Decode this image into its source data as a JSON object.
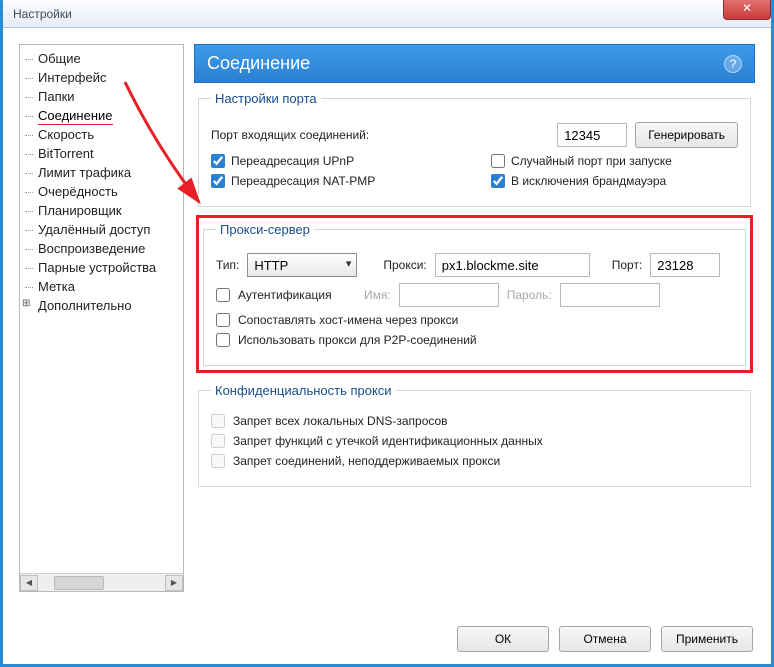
{
  "window": {
    "title": "Настройки"
  },
  "tree": {
    "items": [
      "Общие",
      "Интерфейс",
      "Папки",
      "Соединение",
      "Скорость",
      "BitTorrent",
      "Лимит трафика",
      "Очерёдность",
      "Планировщик",
      "Удалённый доступ",
      "Воспроизведение",
      "Парные устройства",
      "Метка",
      "Дополнительно"
    ],
    "selectedIndex": 3,
    "expandableIndex": 13
  },
  "header": {
    "title": "Соединение"
  },
  "portSettings": {
    "legend": "Настройки порта",
    "portLabel": "Порт входящих соединений:",
    "portValue": "12345",
    "generateBtn": "Генерировать",
    "upnp": "Переадресация UPnP",
    "upnpChecked": true,
    "natpmp": "Переадресация NAT-PMP",
    "natpmpChecked": true,
    "randomPort": "Случайный порт при запуске",
    "randomPortChecked": false,
    "firewall": "В исключения брандмауэра",
    "firewallChecked": true
  },
  "proxy": {
    "legend": "Прокси-сервер",
    "typeLabel": "Тип:",
    "typeValue": "HTTP",
    "proxyLabel": "Прокси:",
    "proxyValue": "px1.blockme.site",
    "portLabel": "Порт:",
    "portValue": "23128",
    "auth": "Аутентификация",
    "authChecked": false,
    "userLabel": "Имя:",
    "userValue": "",
    "passLabel": "Пароль:",
    "passValue": "",
    "hostnames": "Сопоставлять хост-имена через прокси",
    "hostnamesChecked": false,
    "p2p": "Использовать прокси для P2P-соединений",
    "p2pChecked": false
  },
  "privacy": {
    "legend": "Конфиденциальность прокси",
    "dns": "Запрет всех локальных DNS-запросов",
    "dnsChecked": false,
    "leak": "Запрет функций с утечкой идентификационных данных",
    "leakChecked": false,
    "unsupp": "Запрет соединений, неподдерживаемых прокси",
    "unsuppChecked": false
  },
  "footer": {
    "ok": "ОК",
    "cancel": "Отмена",
    "apply": "Применить"
  }
}
